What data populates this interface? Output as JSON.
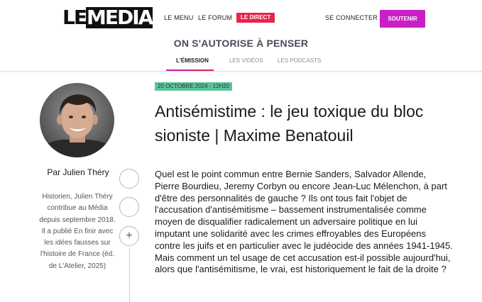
{
  "brand": {
    "logo_text_a": "LE",
    "logo_text_b": "MEDIA",
    "accent_pink": "#e8244a",
    "accent_purple": "#c81fc7",
    "badge_green": "#5cc49a"
  },
  "nav": {
    "menu": "LE MENU",
    "forum": "LE FORUM",
    "live": "LE DIRECT",
    "login": "SE CONNECTER",
    "support": "SOUTENIR"
  },
  "show": {
    "title": "ON S'AUTORISE À PENSER",
    "tabs": [
      "L'ÉMISSION",
      "LES VIDÉOS",
      "LES PODCASTS"
    ],
    "active_tab": 0
  },
  "author": {
    "name": "Par Julien Théry",
    "bio": "Historien, Julien Théry contribue au Média depuis septembre 2018. Il a publié En finir avec les idées fausses sur l'histoire de France (éd. de L'Atelier, 2025)"
  },
  "share_buttons": [
    "",
    "",
    "+"
  ],
  "article": {
    "date": "20 OCTOBRE 2024 - 12H20",
    "title": "Antisémistime : le jeu toxique du bloc sioniste | Maxime Benatouil",
    "lede": "Quel est le point commun entre Bernie Sanders, Salvador Allende, Pierre Bourdieu, Jeremy Corbyn ou encore Jean-Luc Mélenchon, à part d'être des personnalités de gauche ? Ils ont tous fait l'objet de l'accusation d'antisémitisme – bassement instrumentalisée comme moyen de disqualifier radicalement un adversaire politique en lui imputant une solidarité avec les crimes effroyables des Européens contre les juifs et en particulier avec le judéocide des années 1941-1945. Mais comment un tel usage de cet accusation est-il possible aujourd'hui, alors que l'antisémitisme, le vrai, est historiquement le fait de la droite ?"
  }
}
